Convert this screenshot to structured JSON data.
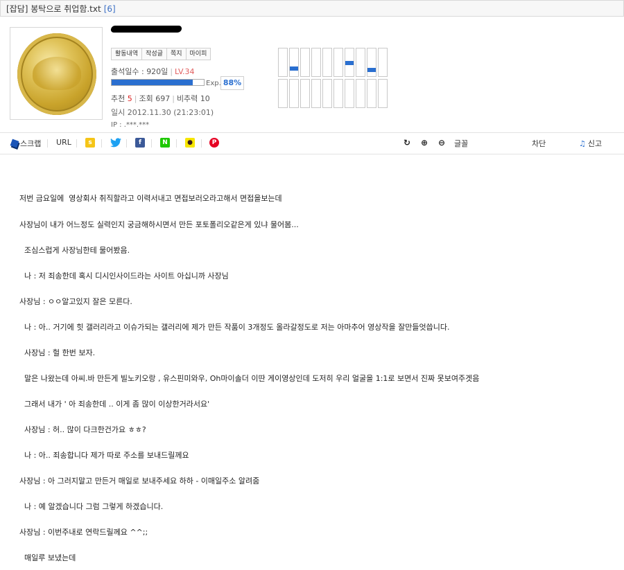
{
  "title": {
    "text": "[잡담] 봉탁으로 취업함.txt",
    "comment_count": "[6]"
  },
  "profile": {
    "tabs": [
      "활동내역",
      "작성글",
      "쪽지",
      "마이피"
    ],
    "attendance_label": "출석일수 :",
    "attendance_value": "920일",
    "level": "LV.34",
    "exp_label": "Exp.",
    "exp_percent": "88%",
    "exp_fraction": 0.88,
    "recommend_label": "추천",
    "recommend_value": "5",
    "views_label": "조회",
    "views_value": "697",
    "not_recommend_label": "비추력",
    "not_recommend_value": "10",
    "date": "일시 2012.11.30 (21:23:01)",
    "ip": "IP : .***.***",
    "activity_levels": [
      0,
      0.2,
      0,
      0,
      0,
      0,
      0.4,
      0,
      0.15,
      0,
      0,
      0,
      0,
      0,
      0,
      0,
      0,
      0,
      0,
      0
    ]
  },
  "toolbar": {
    "scrap": "스크랩",
    "url": "URL",
    "font": "글꼴",
    "block": "차단",
    "report": "신고"
  },
  "body": [
    "저번 금요일에  영상회사 취직할라고 이력서내고 면접보러오라고해서 면접을보는데",
    "사장님이 내가 어느정도 실력인지 궁금해하시면서 만든 포토폴리오같은게 있냐 물어봄...",
    "  조심스럽게 사장님한테 물어봤음.",
    "  나 : 저 죄송한데 혹시 디시인사이드라는 사이트 아십니까 사장님",
    "사장님 : ㅇㅇ알고있지 잘은 모른다.",
    "  나 : 아.. 거기에 힛 갤러리라고 이슈가되는 갤러리에 제가 만든 작품이 3개정도 올라갈정도로 저는 아마추어 영상작을 잘만들엇씁니다.",
    "  사장님 : 헐 한번 보자.",
    "  말은 나왔는데 아씨.바 만든게 빌노키오랑 , 유스핀미와우, Oh마이솔더 이딴 게이영상인데 도저히 우리 얼굴을 1:1로 보면서 진짜 못보여주겟음",
    "  그래서 내가 ' 아 죄송한데 .. 이게 좀 많이 이상한거라서요'",
    "  사장님 : 허.. 많이 다크한건가요 ㅎㅎ?",
    "  나 : 아.. 죄송합니다 제가 따로 주소를 보내드릴께요",
    "사장님 : 아 그러지말고 만든거 매일로 보내주세요 하하 - 이매일주소 알려줌",
    "  나 : 예 알겠습니다 그럼 그렇게 하겠습니다.",
    "사장님 : 이번주내로 연락드릴께요 ^^;;",
    "  매일루 보냈는데"
  ]
}
